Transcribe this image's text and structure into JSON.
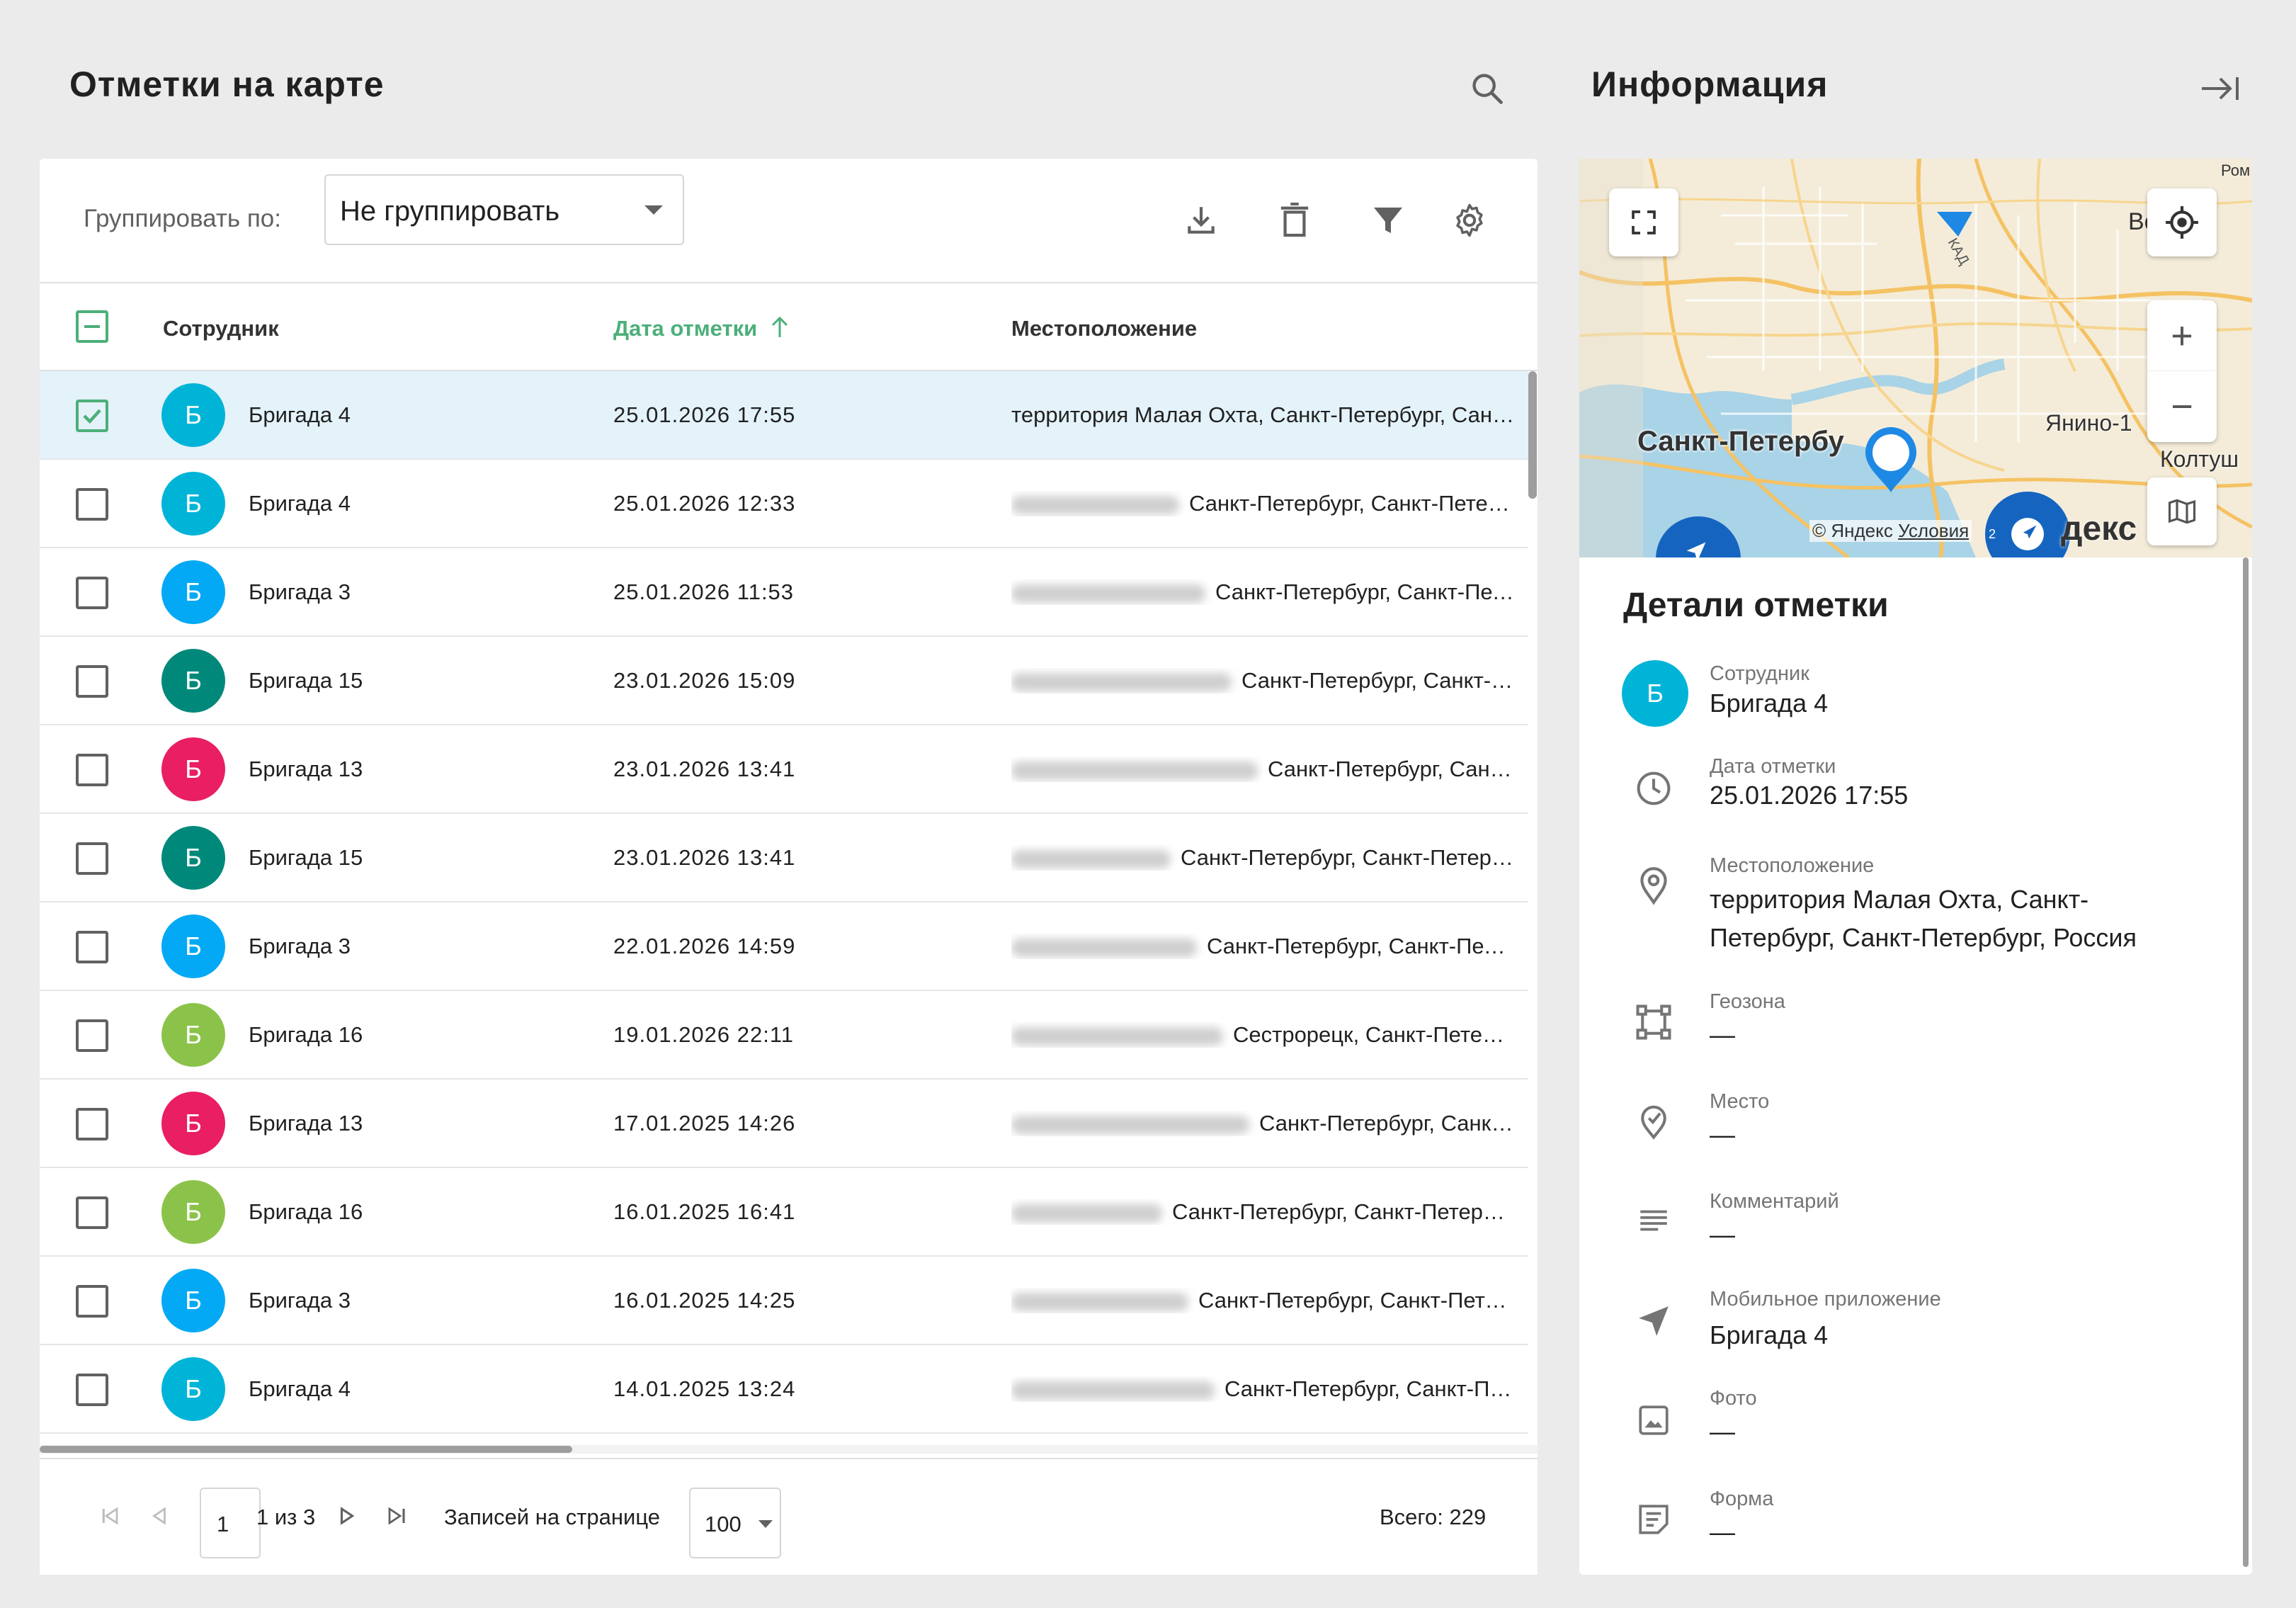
{
  "left_panel": {
    "title": "Отметки на карте"
  },
  "right_panel": {
    "title": "Информация"
  },
  "toolbar": {
    "group_label": "Группировать по:",
    "group_value": "Не группировать"
  },
  "table": {
    "headers": {
      "employee": "Сотрудник",
      "date": "Дата отметки",
      "location": "Местоположение"
    },
    "rows": [
      {
        "initial": "Б",
        "employee": "Бригада 4",
        "date": "25.01.2026 17:55",
        "location": "территория Малая Охта, Санкт-Петербург, Санкт-Петербург, Россия",
        "color": "#00b4d8",
        "selected": true
      },
      {
        "initial": "Б",
        "employee": "Бригада 4",
        "date": "25.01.2026 12:33",
        "location": "Санкт-Петербург, Санкт-Петербург, Россия",
        "color": "#00b4d8",
        "selected": false
      },
      {
        "initial": "Б",
        "employee": "Бригада 3",
        "date": "25.01.2026 11:53",
        "location": "Санкт-Петербург, Санкт-Петербург, Россия",
        "color": "#03a9f4",
        "selected": false
      },
      {
        "initial": "Б",
        "employee": "Бригада 15",
        "date": "23.01.2026 15:09",
        "location": "Санкт-Петербург, Санкт-Петербург, Россия",
        "color": "#00897b",
        "selected": false
      },
      {
        "initial": "Б",
        "employee": "Бригада 13",
        "date": "23.01.2026 13:41",
        "location": "Санкт-Петербург, Санкт-Петербург, Россия",
        "color": "#e91e63",
        "selected": false
      },
      {
        "initial": "Б",
        "employee": "Бригада 15",
        "date": "23.01.2026 13:41",
        "location": "Санкт-Петербург, Санкт-Петербург, Россия",
        "color": "#00897b",
        "selected": false
      },
      {
        "initial": "Б",
        "employee": "Бригада 3",
        "date": "22.01.2026 14:59",
        "location": "Санкт-Петербург, Санкт-Петербург, Россия",
        "color": "#03a9f4",
        "selected": false
      },
      {
        "initial": "Б",
        "employee": "Бригада 16",
        "date": "19.01.2026 22:11",
        "location": "Сестрорецк, Санкт-Петербург, Россия",
        "color": "#8bc34a",
        "selected": false
      },
      {
        "initial": "Б",
        "employee": "Бригада 13",
        "date": "17.01.2025 14:26",
        "location": "Санкт-Петербург, Санкт-Петербург, Россия",
        "color": "#e91e63",
        "selected": false
      },
      {
        "initial": "Б",
        "employee": "Бригада 16",
        "date": "16.01.2025 16:41",
        "location": "Санкт-Петербург, Санкт-Петербург, Россия",
        "color": "#8bc34a",
        "selected": false
      },
      {
        "initial": "Б",
        "employee": "Бригада 3",
        "date": "16.01.2025 14:25",
        "location": "Санкт-Петербург, Санкт-Петербург, Россия",
        "color": "#03a9f4",
        "selected": false
      },
      {
        "initial": "Б",
        "employee": "Бригада 4",
        "date": "14.01.2025 13:24",
        "location": "Санкт-Петербург, Санкт-Петербург, Россия",
        "color": "#00b4d8",
        "selected": false
      }
    ]
  },
  "pagination": {
    "page_value": "1",
    "of_text": "1 из 3",
    "per_page_label": "Записей на странице",
    "per_page_value": "100",
    "total": "Всего: 229"
  },
  "map": {
    "city_label": "Санкт-Петербу",
    "yanino": "Янино-1",
    "koltushi": "Колтуш",
    "top_right": "Ром",
    "vse": "Вс",
    "road_kad": "КАД",
    "copyright": "© Яндекс",
    "terms": "Условия",
    "brand_fragment": "декс К",
    "cluster_count": "2",
    "zoom_in": "+",
    "zoom_out": "−"
  },
  "details": {
    "title": "Детали отметки",
    "avatar_initial": "Б",
    "avatar_color": "#00b4d8",
    "employee_label": "Сотрудник",
    "employee_value": "Бригада 4",
    "date_label": "Дата отметки",
    "date_value": "25.01.2026 17:55",
    "location_label": "Местоположение",
    "location_line1": "территория Малая Охта, Санкт-",
    "location_line2": "Петербург, Санкт-Петербург, Россия",
    "geozone_label": "Геозона",
    "geozone_value": "—",
    "place_label": "Место",
    "place_value": "—",
    "comment_label": "Комментарий",
    "comment_value": "—",
    "app_label": "Мобильное приложение",
    "app_value": "Бригада 4",
    "photo_label": "Фото",
    "photo_value": "—",
    "form_label": "Форма",
    "form_value": "—"
  },
  "colors": {
    "accent": "#4caf7a",
    "selected_row": "#e4f2fa"
  }
}
